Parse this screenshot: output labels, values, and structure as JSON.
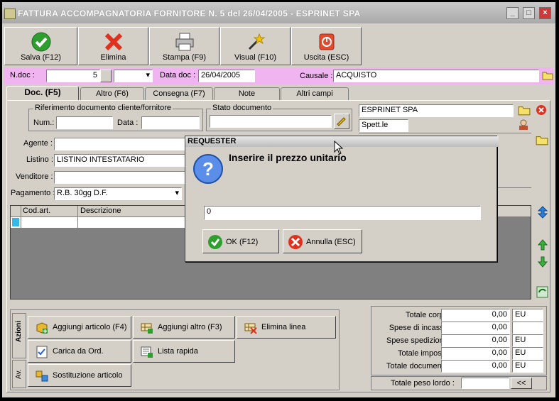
{
  "window": {
    "title": "FATTURA ACCOMPAGNATORIA FORNITORE N. 5  del 26/04/2005 - ESPRINET SPA",
    "min": "_",
    "max": "□",
    "close": "×"
  },
  "toolbar": {
    "save": "Salva (F12)",
    "delete": "Elimina",
    "print": "Stampa (F9)",
    "visual": "Visual (F10)",
    "exit": "Uscita (ESC)"
  },
  "header": {
    "ndoc_label": "N.doc :",
    "ndoc_value": "5",
    "datadoc_label": "Data doc :",
    "datadoc_value": "26/04/2005",
    "causale_label": "Causale :",
    "causale_value": "ACQUISTO"
  },
  "tabs": [
    "Doc. (F5)",
    "Altro (F6)",
    "Consegna (F7)",
    "Note",
    "Altri campi"
  ],
  "riferimento": {
    "title": "Riferimento documento cliente/fornitore",
    "num_label": "Num.:",
    "data_label": "Data :"
  },
  "stato": {
    "title": "Stato documento"
  },
  "supplier": {
    "name": "ESPRINET SPA",
    "salutation": "Spett.le"
  },
  "fields": {
    "agente_label": "Agente :",
    "listino_label": "Listino :",
    "listino_value": "LISTINO INTESTATARIO",
    "venditore_label": "Venditore :",
    "pagamento_label": "Pagamento :",
    "pagamento_value": "R.B. 30gg D.F."
  },
  "grid": {
    "columns": [
      "Cod.art.",
      "Descrizione"
    ]
  },
  "dialog": {
    "title": "REQUESTER",
    "message": "Inserire il prezzo unitario",
    "input_value": "0",
    "ok": "OK (F12)",
    "cancel": "Annulla (ESC)"
  },
  "azioni": {
    "tab_label": "Azioni",
    "tab2_label": "Av.",
    "add_article": "Aggiungi articolo (F4)",
    "add_other": "Aggiungi altro (F3)",
    "delete_line": "Elimina linea",
    "load_order": "Carica da Ord.",
    "quick_list": "Lista rapida",
    "replace_article": "Sostituzione articolo"
  },
  "totals": {
    "rows": [
      {
        "label": "Totale corpo :",
        "value": "0,00",
        "unit": "EU"
      },
      {
        "label": "Spese di incasso :",
        "value": "0,00",
        "unit": ""
      },
      {
        "label": "Spese spedizione :",
        "value": "0,00",
        "unit": "EU"
      },
      {
        "label": "Totale imposte :",
        "value": "0,00",
        "unit": "EU"
      },
      {
        "label": "Totale documento :",
        "value": "0,00",
        "unit": "EU"
      }
    ],
    "peso_label": "Totale peso lordo :",
    "peso_button": "<<"
  },
  "colors": {
    "pink": "#f0b4f0",
    "face": "#d4d0c8",
    "grid": "#808080"
  }
}
